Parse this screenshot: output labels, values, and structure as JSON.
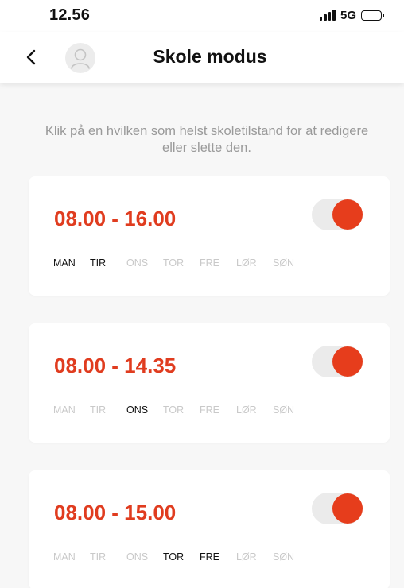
{
  "status_bar": {
    "time": "12.56",
    "network": "5G"
  },
  "header": {
    "title": "Skole modus"
  },
  "instructions": "Klik på en hvilken som helst skoletilstand for at redigere eller slette den.",
  "colors": {
    "accent": "#e03c1f",
    "toggle_on": "#e63d1c",
    "inactive_day": "#c9c9c9"
  },
  "schedules": [
    {
      "time": "08.00 - 16.00",
      "enabled": true,
      "days": [
        {
          "label": "MAN",
          "active": true
        },
        {
          "label": "TIR",
          "active": true
        },
        {
          "label": "ONS",
          "active": false
        },
        {
          "label": "TOR",
          "active": false
        },
        {
          "label": "FRE",
          "active": false
        },
        {
          "label": "LØR",
          "active": false
        },
        {
          "label": "SØN",
          "active": false
        }
      ]
    },
    {
      "time": "08.00 - 14.35",
      "enabled": true,
      "days": [
        {
          "label": "MAN",
          "active": false
        },
        {
          "label": "TIR",
          "active": false
        },
        {
          "label": "ONS",
          "active": true
        },
        {
          "label": "TOR",
          "active": false
        },
        {
          "label": "FRE",
          "active": false
        },
        {
          "label": "LØR",
          "active": false
        },
        {
          "label": "SØN",
          "active": false
        }
      ]
    },
    {
      "time": "08.00 - 15.00",
      "enabled": true,
      "days": [
        {
          "label": "MAN",
          "active": false
        },
        {
          "label": "TIR",
          "active": false
        },
        {
          "label": "ONS",
          "active": false
        },
        {
          "label": "TOR",
          "active": true
        },
        {
          "label": "FRE",
          "active": true
        },
        {
          "label": "LØR",
          "active": false
        },
        {
          "label": "SØN",
          "active": false
        }
      ]
    }
  ]
}
